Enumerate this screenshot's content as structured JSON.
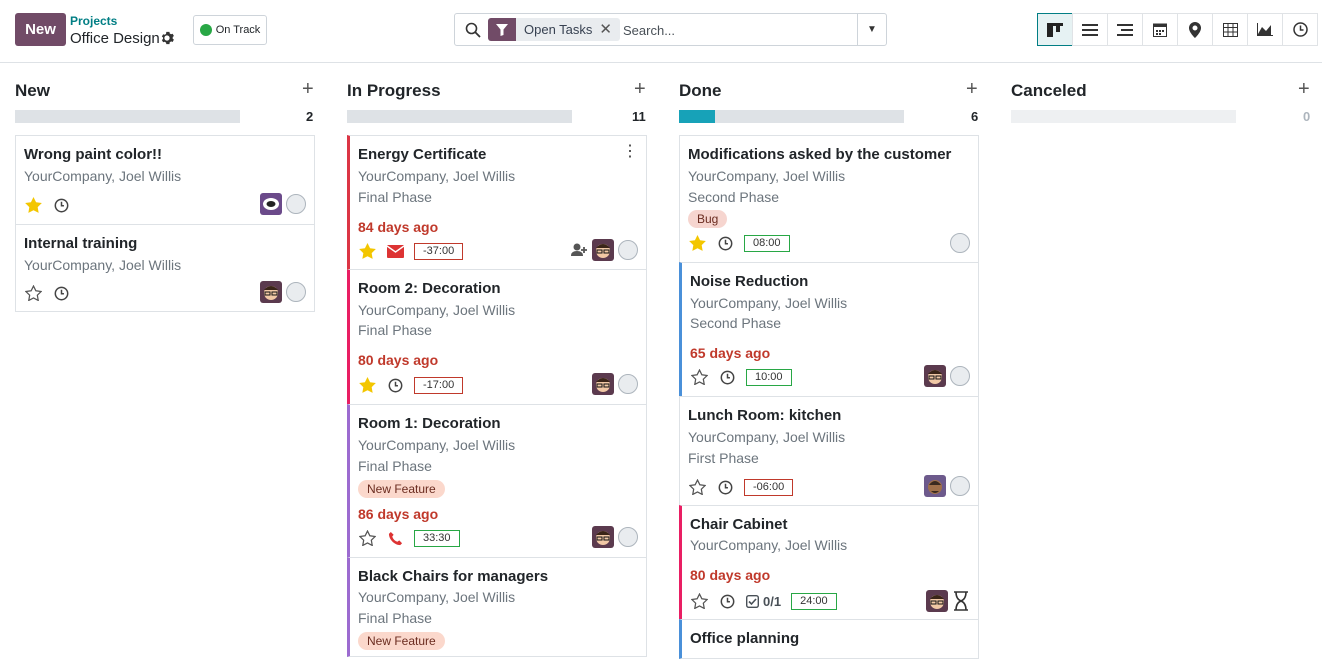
{
  "header": {
    "new_label": "New",
    "breadcrumb_parent": "Projects",
    "breadcrumb_current": "Office Design",
    "status_label": "On Track",
    "facet_label": "Open Tasks",
    "search_placeholder": "Search..."
  },
  "views": [
    "kanban-icon",
    "list-icon",
    "gantt-icon",
    "calendar-icon",
    "map-icon",
    "pivot-icon",
    "graph-icon",
    "activity-icon"
  ],
  "colors": {
    "accent": "#714b67",
    "link": "#017e84",
    "done_progress": "#17a2b8",
    "status_on_track": "#28a745",
    "overdue": "#c0392b"
  },
  "columns": [
    {
      "title": "New",
      "count": "2",
      "done_fraction": 0
    },
    {
      "title": "In Progress",
      "count": "11",
      "done_fraction": 0
    },
    {
      "title": "Done",
      "count": "6",
      "done_fraction": 0.16
    },
    {
      "title": "Canceled",
      "count": "0",
      "done_fraction": 0
    }
  ],
  "cards": {
    "c1": {
      "title": "Wrong paint color!!",
      "company": "YourCompany, Joel Willis"
    },
    "c2": {
      "title": "Internal training",
      "company": "YourCompany, Joel Willis"
    },
    "c3": {
      "title": "Energy Certificate",
      "company": "YourCompany, Joel Willis",
      "phase": "Final Phase",
      "deadline": "84 days ago",
      "hours": "-37:00"
    },
    "c4": {
      "title": "Room 2: Decoration",
      "company": "YourCompany, Joel Willis",
      "phase": "Final Phase",
      "deadline": "80 days ago",
      "hours": "-17:00"
    },
    "c5": {
      "title": "Room 1: Decoration",
      "company": "YourCompany, Joel Willis",
      "phase": "Final Phase",
      "tag": "New Feature",
      "deadline": "86 days ago",
      "hours": "33:30"
    },
    "c6": {
      "title": "Black Chairs for managers",
      "company": "YourCompany, Joel Willis",
      "phase": "Final Phase",
      "tag": "New Feature"
    },
    "d1": {
      "title": "Modifications asked by the customer",
      "company": "YourCompany, Joel Willis",
      "phase": "Second Phase",
      "tag": "Bug",
      "hours": "08:00"
    },
    "d2": {
      "title": "Noise Reduction",
      "company": "YourCompany, Joel Willis",
      "phase": "Second Phase",
      "deadline": "65 days ago",
      "hours": "10:00"
    },
    "d3": {
      "title": "Lunch Room: kitchen",
      "company": "YourCompany, Joel Willis",
      "phase": "First Phase",
      "hours": "-06:00"
    },
    "d4": {
      "title": "Chair Cabinet",
      "company": "YourCompany, Joel Willis",
      "deadline": "80 days ago",
      "subtasks": "0/1",
      "hours": "24:00"
    },
    "d5": {
      "title": "Office planning"
    }
  }
}
